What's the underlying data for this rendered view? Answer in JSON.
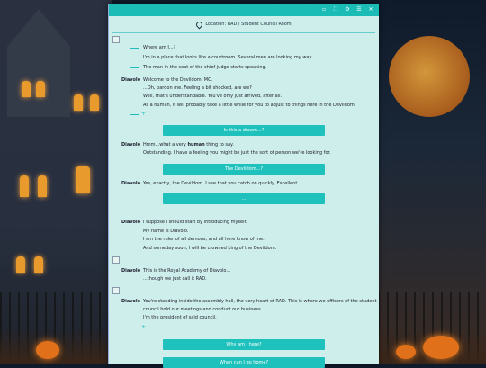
{
  "location": {
    "label": "Location: RAD / Student Council Room"
  },
  "narration": [
    "Where am I...?",
    "I'm in a place that looks like a courtroom. Several men are looking my way.",
    "The man in the seat of the chief judge starts speaking."
  ],
  "speaker": "Diavolo",
  "block1": [
    "Welcome to the Devildom, MC.",
    "...Oh, pardon me. Feeling a bit shocked, are we?",
    "Well, that's understandable. You've only just arrived, after all.",
    "As a human, it will probably take a little while for you to adjust to things here in the Devildom."
  ],
  "choices": {
    "c1": "Is this a dream...?",
    "c2": "The Devildom...?",
    "c3": "...",
    "c4": "Why am I here?",
    "c5": "When can I go home?"
  },
  "block2": {
    "pre": "Hmm...what a very ",
    "bold": "human",
    "post": " thing to say.",
    "l2": "Outstanding. I have a feeling you might be just the sort of person we're looking for."
  },
  "block3": "Yes, exactly, the Devildom. I see that you catch on quickly. Excellent.",
  "block4": [
    "I suppose I should start by introducing myself.",
    "My name is Diavolo.",
    "I am the ruler of all demons, and all here know of me.",
    "And someday soon, I will be crowned king of the Devildom."
  ],
  "block5": [
    "This is the Royal Academy of Diavolo...",
    "...though we just call it RAD."
  ],
  "block6": [
    "You're standing inside the assembly hall, the very heart of RAD. This is where we officers of the student",
    "council hold our meetings and conduct our business.",
    "I'm the president of said council."
  ]
}
